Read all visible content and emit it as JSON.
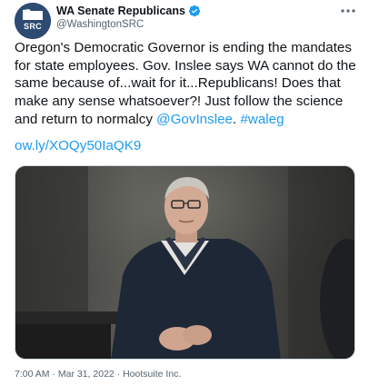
{
  "account": {
    "display_name": "WA Senate Republicans",
    "handle": "@WashingtonSRC",
    "avatar_text": "SRC",
    "verified": true
  },
  "tweet": {
    "text_before": "Oregon's Democratic Governor is ending the mandates for state employees. Gov. Inslee says WA cannot do the same because of...wait for it...Republicans! Does that make any sense whatsoever?! Just follow the science and return to normalcy ",
    "mention": "@GovInslee",
    "separator": ". ",
    "hashtag": "#waleg",
    "short_link": "ow.ly/XOQy50IaQK9"
  },
  "meta": {
    "time": "7:00 AM",
    "date": "Mar 31, 2022",
    "source": "Hootsuite Inc.",
    "separator": "·"
  },
  "colors": {
    "link": "#1d9bf0",
    "text": "#0f1419",
    "secondary": "#536471",
    "verified_badge": "#1d9bf0",
    "avatar_bg": "#2d4a73"
  },
  "icons": {
    "more": "more-horizontal-icon",
    "verified": "verified-badge-icon"
  }
}
